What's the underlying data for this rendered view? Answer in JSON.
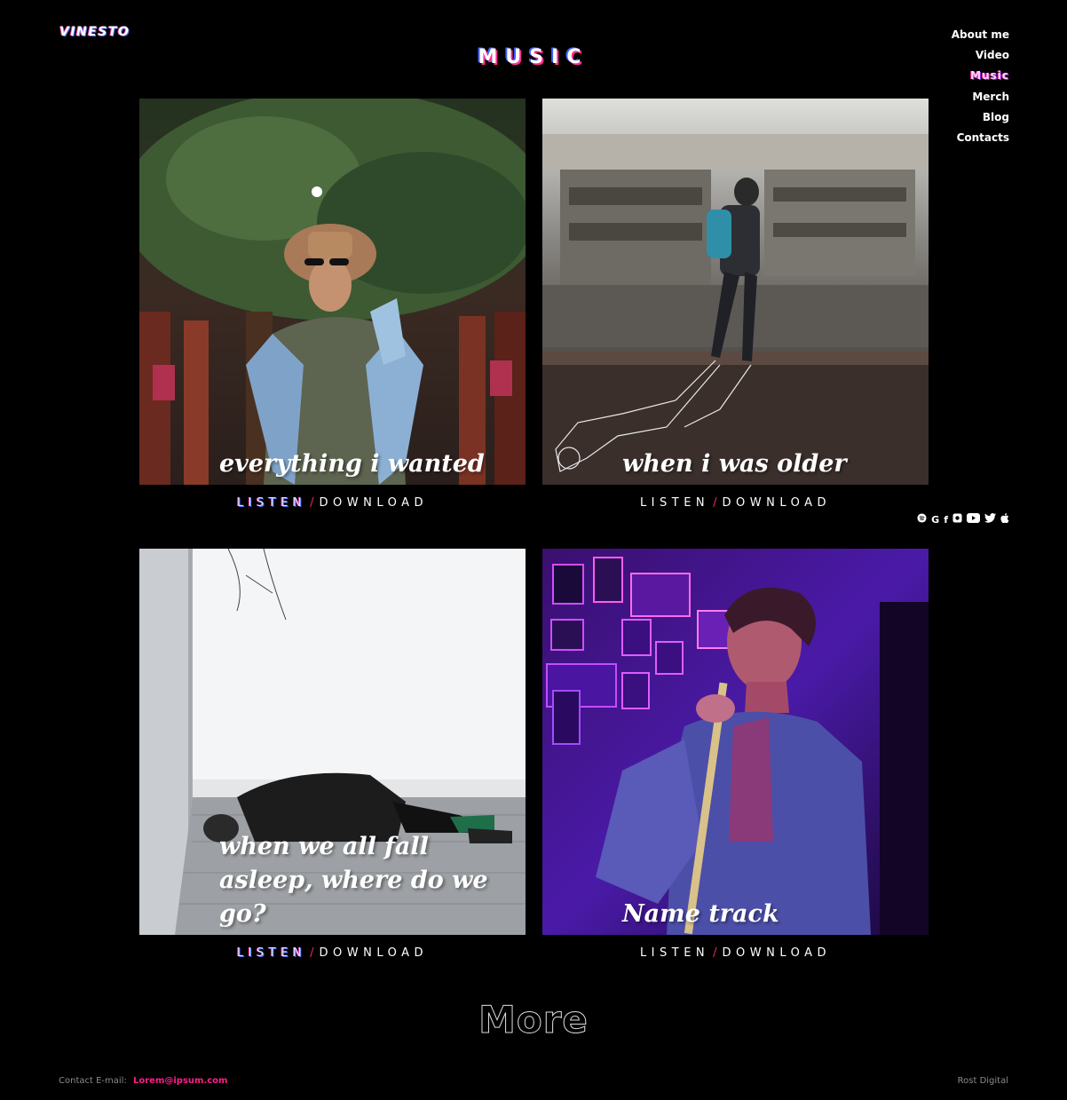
{
  "logo": "VINESTO",
  "page_title": "MUSIC",
  "nav": {
    "items": [
      {
        "label": "About me",
        "active": false
      },
      {
        "label": "Video",
        "active": false
      },
      {
        "label": "Music",
        "active": true
      },
      {
        "label": "Merch",
        "active": false
      },
      {
        "label": "Blog",
        "active": false
      },
      {
        "label": "Contacts",
        "active": false
      }
    ]
  },
  "socials": [
    "spotify-icon",
    "google-icon",
    "facebook-icon",
    "instagram-icon",
    "youtube-icon",
    "twitter-icon",
    "apple-icon"
  ],
  "tracks": [
    {
      "title": "everything i wanted",
      "listen": "LISTEN",
      "sep": "/",
      "download": "DOWNLOAD"
    },
    {
      "title": "when i was older",
      "listen": "LISTEN",
      "sep": "/",
      "download": "DOWNLOAD"
    },
    {
      "title": "when we all fall asleep, where do we go?",
      "listen": "LISTEN",
      "sep": "/",
      "download": "DOWNLOAD"
    },
    {
      "title": "Name track",
      "listen": "LISTEN",
      "sep": "/",
      "download": "DOWNLOAD"
    }
  ],
  "more_label": "More",
  "footer": {
    "contact_label": "Contact E-mail:",
    "email": "Lorem@ipsum.com",
    "credit": "Rost Digital"
  },
  "colors": {
    "background": "#000000",
    "accent_pink": "#ff1f87",
    "accent_blue": "#4a6aff"
  }
}
